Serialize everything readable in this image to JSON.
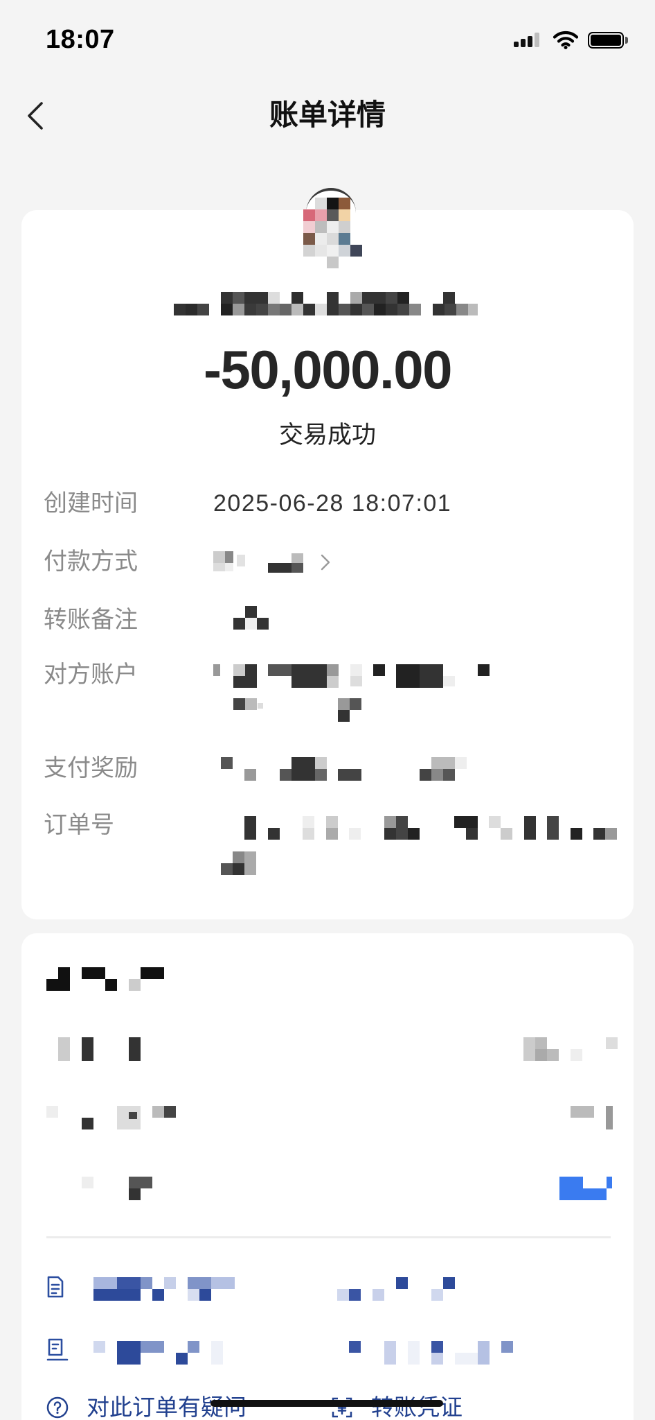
{
  "status_bar": {
    "time": "18:07",
    "icons": [
      "signal-icon",
      "wifi-icon",
      "battery-icon"
    ]
  },
  "header": {
    "title": "账单详情",
    "back_icon": "chevron-left-icon"
  },
  "summary": {
    "amount": "-50,000.00",
    "status": "交易成功"
  },
  "details": [
    {
      "label": "创建时间",
      "value": "2025-06-28 18:07:01"
    },
    {
      "label": "付款方式",
      "icon": "chevron-right-icon"
    },
    {
      "label": "转账备注"
    },
    {
      "label": "对方账户"
    },
    {
      "label": "支付奖励"
    },
    {
      "label": "订单号"
    }
  ],
  "links": {
    "icons": [
      "receipt-icon",
      "invoice-icon"
    ]
  },
  "actions": [
    {
      "label": "对此订单有疑问",
      "icon": "question-circle-icon"
    },
    {
      "label": "转账凭证",
      "icon": "yuan-voucher-icon"
    }
  ],
  "colors": {
    "page_background": "#f4f4f4",
    "card": "#ffffff",
    "label": "#8a8a8a",
    "accent": "#22418f",
    "highlight": "#3a7bf0"
  }
}
